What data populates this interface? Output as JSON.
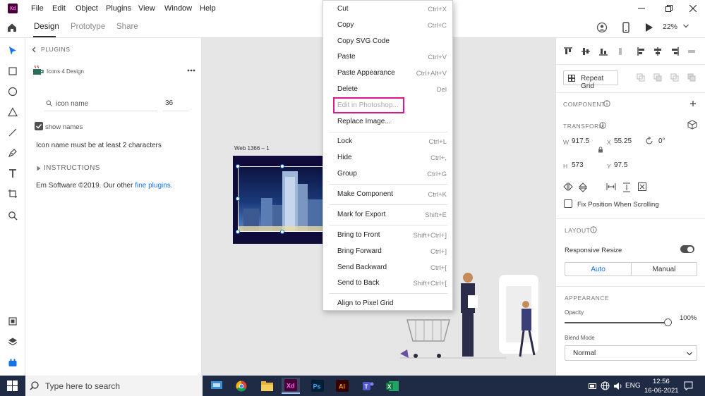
{
  "titlebar": {
    "logo": "Xd",
    "menus": [
      "File",
      "Edit",
      "Object",
      "Plugins",
      "View",
      "Window",
      "Help"
    ],
    "zoom": "22%"
  },
  "tabs": [
    "Design",
    "Prototype",
    "Share"
  ],
  "plugin_panel": {
    "breadcrumb": "PLUGINS",
    "plugin_name": "Icons 4 Design",
    "search_placeholder": "icon name",
    "size_value": "36",
    "show_names_label": "show names",
    "warning": "Icon name must be at least 2 characters",
    "instructions_label": "INSTRUCTIONS",
    "footer_text": "Em Software ©2019. Our other",
    "footer_link": "fine plugins.",
    "footer_end": ""
  },
  "canvas": {
    "artboard_label": "Web 1366 – 1"
  },
  "context_menu": {
    "items": [
      {
        "label": "Cut",
        "shortcut": "Ctrl+X"
      },
      {
        "label": "Copy",
        "shortcut": "Ctrl+C"
      },
      {
        "label": "Copy SVG Code",
        "shortcut": ""
      },
      {
        "label": "Paste",
        "shortcut": "Ctrl+V"
      },
      {
        "label": "Paste Appearance",
        "shortcut": "Ctrl+Alt+V"
      },
      {
        "label": "Delete",
        "shortcut": "Del"
      },
      {
        "label": "Edit in Photoshop...",
        "shortcut": ""
      },
      {
        "label": "Replace Image...",
        "shortcut": ""
      },
      {
        "label": "Lock",
        "shortcut": "Ctrl+L"
      },
      {
        "label": "Hide",
        "shortcut": "Ctrl+,"
      },
      {
        "label": "Group",
        "shortcut": "Ctrl+G"
      },
      {
        "label": "Make Component",
        "shortcut": "Ctrl+K"
      },
      {
        "label": "Mark for Export",
        "shortcut": "Shift+E"
      },
      {
        "label": "Bring to Front",
        "shortcut": "Shift+Ctrl+]"
      },
      {
        "label": "Bring Forward",
        "shortcut": "Ctrl+]"
      },
      {
        "label": "Send Backward",
        "shortcut": "Ctrl+["
      },
      {
        "label": "Send to Back",
        "shortcut": "Shift+Ctrl+["
      },
      {
        "label": "Align to Pixel Grid",
        "shortcut": ""
      }
    ],
    "highlight_color": "#e0168c"
  },
  "right_panel": {
    "repeat_grid": "Repeat Grid",
    "component_label": "COMPONENT",
    "transform_label": "TRANSFORM",
    "w_label": "W",
    "w_value": "917.5",
    "h_label": "H",
    "h_value": "573",
    "x_label": "X",
    "x_value": "55.25",
    "y_label": "Y",
    "y_value": "97.5",
    "rotation": "0°",
    "fix_position": "Fix Position When Scrolling",
    "layout_label": "LAYOUT",
    "responsive_resize": "Responsive Resize",
    "auto_label": "Auto",
    "manual_label": "Manual",
    "appearance_label": "APPEARANCE",
    "opacity_label": "Opacity",
    "opacity_value": "100%",
    "blend_label": "Blend Mode",
    "blend_value": "Normal"
  },
  "taskbar": {
    "search_placeholder": "Type here to search",
    "lang": "ENG",
    "time": "12:56",
    "date": "16-06-2021"
  },
  "colors": {
    "accent_blue": "#1473e6",
    "taskbar": "#1f2a44",
    "xd_purple": "#470137"
  }
}
